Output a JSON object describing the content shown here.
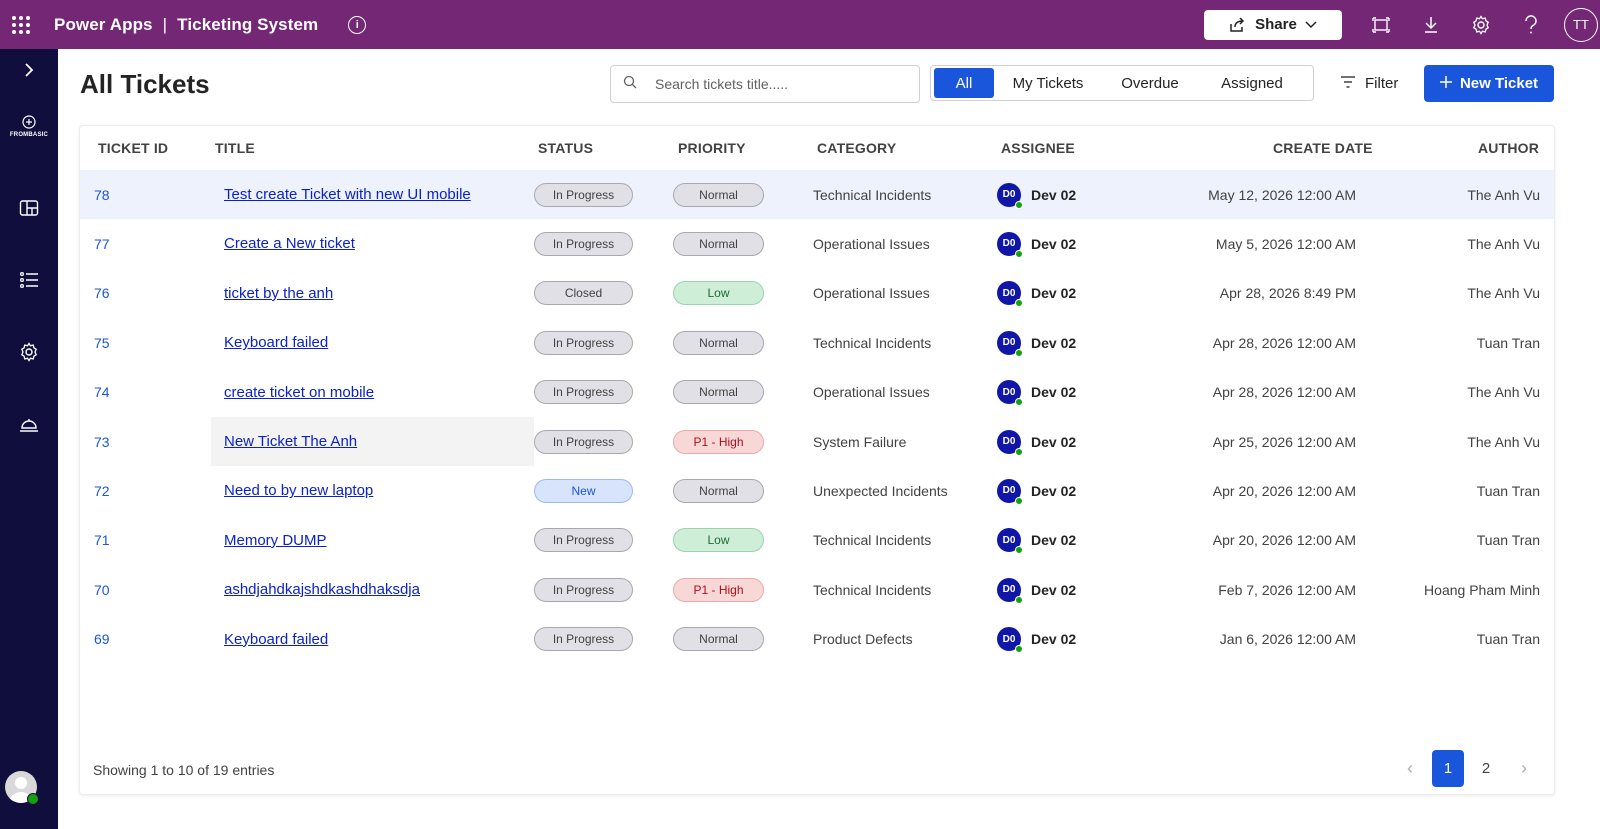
{
  "topbar": {
    "app": "Power Apps",
    "separator": "|",
    "title": "Ticketing System",
    "share_label": "Share",
    "user_initials": "TT"
  },
  "rail": {
    "logo_text": "FROMBASIC"
  },
  "page": {
    "title": "All Tickets",
    "search_placeholder": "Search tickets title.....",
    "tabs": [
      "All",
      "My Tickets",
      "Overdue",
      "Assigned"
    ],
    "active_tab": "All",
    "filter_label": "Filter",
    "new_ticket_label": "New Ticket"
  },
  "table": {
    "headers": {
      "id": "TICKET ID",
      "title": "TITLE",
      "status": "STATUS",
      "priority": "PRIORITY",
      "category": "CATEGORY",
      "assignee": "ASSIGNEE",
      "date": "CREATE DATE",
      "author": "AUTHOR"
    },
    "rows": [
      {
        "id": "78",
        "title": "Test create Ticket with new UI mobile",
        "status": "In Progress",
        "priority": "Normal",
        "category": "Technical Incidents",
        "assignee_initials": "D0",
        "assignee": "Dev 02",
        "date": "May 12, 2026 12:00 AM",
        "author": "The Anh Vu"
      },
      {
        "id": "77",
        "title": "Create a New ticket",
        "status": "In Progress",
        "priority": "Normal",
        "category": "Operational Issues",
        "assignee_initials": "D0",
        "assignee": "Dev 02",
        "date": "May 5, 2026 12:00 AM",
        "author": "The Anh Vu"
      },
      {
        "id": "76",
        "title": "ticket by the anh",
        "status": "Closed",
        "priority": "Low",
        "category": "Operational Issues",
        "assignee_initials": "D0",
        "assignee": "Dev 02",
        "date": "Apr 28, 2026 8:49 PM",
        "author": "The Anh Vu"
      },
      {
        "id": "75",
        "title": "Keyboard failed",
        "status": "In Progress",
        "priority": "Normal",
        "category": "Technical Incidents",
        "assignee_initials": "D0",
        "assignee": "Dev 02",
        "date": "Apr 28, 2026 12:00 AM",
        "author": "Tuan Tran"
      },
      {
        "id": "74",
        "title": "create ticket on mobile",
        "status": "In Progress",
        "priority": "Normal",
        "category": "Operational Issues",
        "assignee_initials": "D0",
        "assignee": "Dev 02",
        "date": "Apr 28, 2026 12:00 AM",
        "author": "The Anh Vu"
      },
      {
        "id": "73",
        "title": "New Ticket The Anh",
        "status": "In Progress",
        "priority": "P1 - High",
        "category": "System Failure",
        "assignee_initials": "D0",
        "assignee": "Dev 02",
        "date": "Apr 25, 2026 12:00 AM",
        "author": "The Anh Vu"
      },
      {
        "id": "72",
        "title": "Need to by new laptop",
        "status": "New",
        "priority": "Normal",
        "category": "Unexpected Incidents",
        "assignee_initials": "D0",
        "assignee": "Dev 02",
        "date": "Apr 20, 2026 12:00 AM",
        "author": "Tuan Tran"
      },
      {
        "id": "71",
        "title": "Memory DUMP",
        "status": "In Progress",
        "priority": "Low",
        "category": "Technical Incidents",
        "assignee_initials": "D0",
        "assignee": "Dev 02",
        "date": "Apr 20, 2026 12:00 AM",
        "author": "Tuan Tran"
      },
      {
        "id": "70",
        "title": "ashdjahdkajshdkashdhaksdja",
        "status": "In Progress",
        "priority": "P1 - High",
        "category": "Technical Incidents",
        "assignee_initials": "D0",
        "assignee": "Dev 02",
        "date": "Feb 7, 2026 12:00 AM",
        "author": "Hoang Pham Minh"
      },
      {
        "id": "69",
        "title": "Keyboard failed",
        "status": "In Progress",
        "priority": "Normal",
        "category": "Product Defects",
        "assignee_initials": "D0",
        "assignee": "Dev 02",
        "date": "Jan 6, 2026 12:00 AM",
        "author": "Tuan Tran"
      }
    ]
  },
  "footer": {
    "entries_text": "Showing 1 to 10 of 19 entries",
    "pages": [
      "1",
      "2"
    ],
    "current_page": "1"
  }
}
